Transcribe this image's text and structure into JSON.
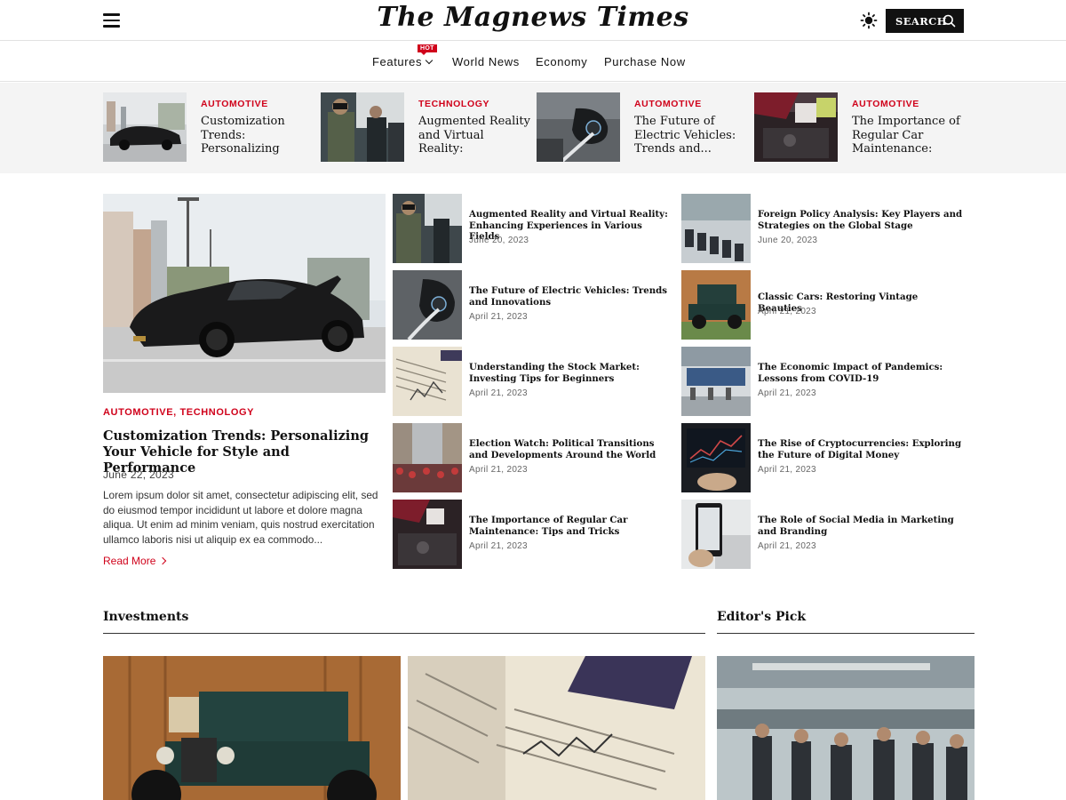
{
  "header": {
    "logo": "The Magnews Times",
    "search_label": "SEARCH"
  },
  "nav": {
    "items": [
      {
        "label": "Features"
      },
      {
        "label": "World News"
      },
      {
        "label": "Economy"
      },
      {
        "label": "Purchase Now"
      }
    ],
    "hot_badge": "HOT"
  },
  "strip": [
    {
      "category": "AUTOMOTIVE",
      "title": "Customization Trends: Personalizing Your..."
    },
    {
      "category": "TECHNOLOGY",
      "title": "Augmented Reality and Virtual Reality: Enhancing..."
    },
    {
      "category": "AUTOMOTIVE",
      "title": "The Future of Electric Vehicles: Trends and..."
    },
    {
      "category": "AUTOMOTIVE",
      "title": "The Importance of Regular Car Maintenance: Tips..."
    }
  ],
  "featured": {
    "cat1": "AUTOMOTIVE",
    "cat_sep": ", ",
    "cat2": "TECHNOLOGY",
    "title": "Customization Trends: Personalizing Your Vehicle for Style and Performance",
    "date": "June 22, 2023",
    "excerpt": "Lorem ipsum dolor sit amet, consectetur adipiscing elit, sed do eiusmod tempor incididunt ut labore et dolore magna aliqua. Ut enim ad minim veniam, quis nostrud exercitation ullamco laboris nisi ut aliquip ex ea commodo...",
    "read_more": "Read More"
  },
  "middle_list": [
    {
      "title": "Augmented Reality and Virtual Reality: Enhancing Experiences in Various Fields",
      "date": "June 20, 2023"
    },
    {
      "title": "The Future of Electric Vehicles: Trends and Innovations",
      "date": "April 21, 2023"
    },
    {
      "title": "Understanding the Stock Market: Investing Tips for Beginners",
      "date": "April 21, 2023"
    },
    {
      "title": "Election Watch: Political Transitions and Developments Around the World",
      "date": "April 21, 2023"
    },
    {
      "title": "The Importance of Regular Car Maintenance: Tips and Tricks",
      "date": "April 21, 2023"
    }
  ],
  "right_list": [
    {
      "title": "Foreign Policy Analysis: Key Players and Strategies on the Global Stage",
      "date": "June 20, 2023"
    },
    {
      "title": "Classic Cars: Restoring Vintage Beauties",
      "date": "April 21, 2023"
    },
    {
      "title": "The Economic Impact of Pandemics: Lessons from COVID-19",
      "date": "April 21, 2023"
    },
    {
      "title": "The Rise of Cryptocurrencies: Exploring the Future of Digital Money",
      "date": "April 21, 2023"
    },
    {
      "title": "The Role of Social Media in Marketing and Branding",
      "date": "April 21, 2023"
    }
  ],
  "sections": {
    "investments": "Investments",
    "editors_pick": "Editor's Pick"
  },
  "colors": {
    "accent": "#d0021b",
    "strip_bg": "#f4f4f4",
    "text": "#111111"
  }
}
